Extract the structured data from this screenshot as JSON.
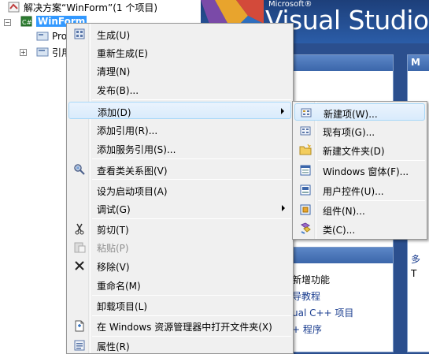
{
  "solution_explorer": {
    "solution_label": "解决方案“WinForm”(1 个项目)",
    "project_label": "WinForm",
    "project_lang_badge": "C#",
    "child_properties": "Pro",
    "child_references": "引用"
  },
  "start_page": {
    "ms_label": "Microsoft®",
    "product_label": "Visual Studio T",
    "right_letter": "M",
    "right_item1": "多",
    "right_item2": "T",
    "link_new_features": "新增功能",
    "link_tutorial": "导教程",
    "link_vcpp": "ual C++ 项目",
    "link_program": "+ 程序"
  },
  "context_menu": {
    "items": [
      {
        "label": "生成(U)",
        "icon": "build-icon"
      },
      {
        "label": "重新生成(E)"
      },
      {
        "label": "清理(N)"
      },
      {
        "label": "发布(B)..."
      },
      {
        "label": "添加(D)"
      },
      {
        "label": "添加引用(R)..."
      },
      {
        "label": "添加服务引用(S)..."
      },
      {
        "label": "查看类关系图(V)",
        "icon": "class-diagram-icon"
      },
      {
        "label": "设为启动项目(A)"
      },
      {
        "label": "调试(G)"
      },
      {
        "label": "剪切(T)",
        "icon": "cut-icon"
      },
      {
        "label": "粘贴(P)",
        "icon": "paste-icon"
      },
      {
        "label": "移除(V)",
        "icon": "remove-icon"
      },
      {
        "label": "重命名(M)"
      },
      {
        "label": "卸载项目(L)"
      },
      {
        "label": "在 Windows 资源管理器中打开文件夹(X)",
        "icon": "open-folder-icon"
      },
      {
        "label": "属性(R)",
        "icon": "properties-icon"
      }
    ]
  },
  "submenu": {
    "items": [
      {
        "label": "新建项(W)...",
        "icon": "new-item-icon"
      },
      {
        "label": "现有项(G)...",
        "icon": "existing-item-icon"
      },
      {
        "label": "新建文件夹(D)",
        "icon": "new-folder-icon"
      },
      {
        "label": "Windows 窗体(F)...",
        "icon": "windows-form-icon"
      },
      {
        "label": "用户控件(U)...",
        "icon": "user-control-icon"
      },
      {
        "label": "组件(N)...",
        "icon": "component-icon"
      },
      {
        "label": "类(C)...",
        "icon": "class-icon"
      }
    ]
  }
}
